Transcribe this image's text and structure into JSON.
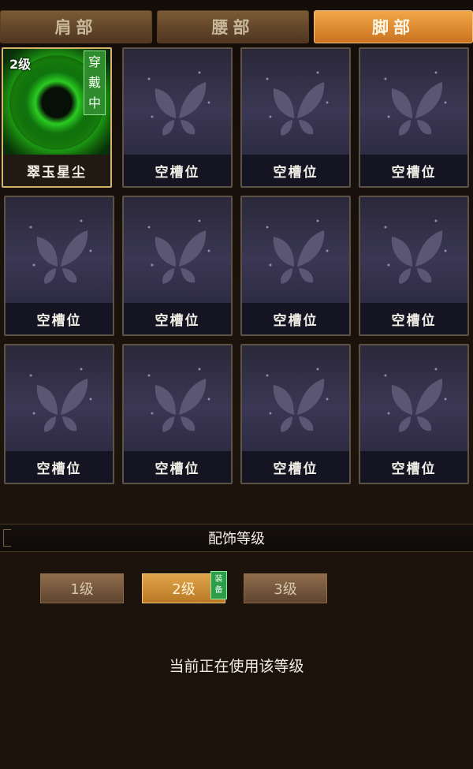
{
  "tabs": [
    {
      "label": "肩部",
      "state": "inactive"
    },
    {
      "label": "腰部",
      "state": "inactive"
    },
    {
      "label": "脚部",
      "state": "active"
    }
  ],
  "slots": [
    {
      "label": "翠玉星尘",
      "level": "2级",
      "equipped_tag": [
        "穿",
        "戴",
        "中"
      ],
      "icon": "green-star-dust-icon"
    },
    {
      "label": "空槽位",
      "icon": "butterfly-icon"
    },
    {
      "label": "空槽位",
      "icon": "butterfly-icon"
    },
    {
      "label": "空槽位",
      "icon": "butterfly-icon"
    },
    {
      "label": "空槽位",
      "icon": "butterfly-icon"
    },
    {
      "label": "空槽位",
      "icon": "butterfly-icon"
    },
    {
      "label": "空槽位",
      "icon": "butterfly-icon"
    },
    {
      "label": "空槽位",
      "icon": "butterfly-icon"
    },
    {
      "label": "空槽位",
      "icon": "butterfly-icon"
    },
    {
      "label": "空槽位",
      "icon": "butterfly-icon"
    },
    {
      "label": "空槽位",
      "icon": "butterfly-icon"
    },
    {
      "label": "空槽位",
      "icon": "butterfly-icon"
    }
  ],
  "level_section": {
    "title": "配饰等级",
    "buttons": [
      {
        "label": "1级"
      },
      {
        "label": "2级",
        "tag": [
          "装",
          "备"
        ]
      },
      {
        "label": "3级"
      }
    ],
    "status": "当前正在使用该等级"
  },
  "colors": {
    "active_tab": "#d98a2e",
    "equipped_green": "#2f8c2d",
    "accent_gold": "#d5b36a"
  }
}
